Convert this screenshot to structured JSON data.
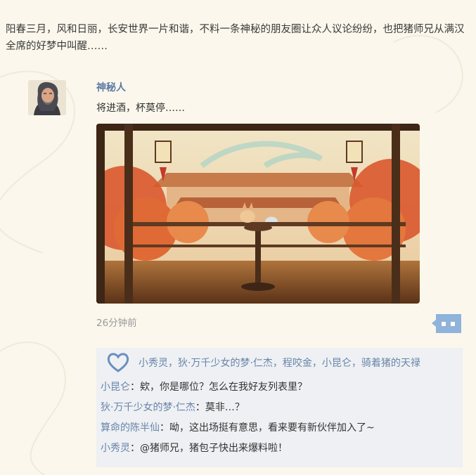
{
  "intro_text": "阳春三月，风和日丽，长安世界一片和谐，不料一条神秘的朋友圈让众人议论纷纷，也把猪师兄从满汉全席的好梦中叫醒……",
  "post": {
    "author": "神秘人",
    "text": "将进酒，杯莫停……",
    "time": "26分钟前",
    "image_alt": "autumn-pavilion-illustration"
  },
  "likes": "小秀灵，狄·万千少女的梦·仁杰，程咬金，小昆仑，骑着猪的天禄",
  "comments": [
    {
      "name": "小昆仑",
      "text": "：欸，你是哪位？怎么在我好友列表里？"
    },
    {
      "name": "狄·万千少女的梦·仁杰",
      "text": "：莫非…？"
    },
    {
      "name": "算命的陈半仙",
      "text": "：呦，这出场挺有意思，看来要有新伙伴加入了~"
    },
    {
      "name": "小秀灵",
      "text": "：@猪师兄，猪包子快出来爆料啦！"
    }
  ],
  "colors": {
    "background": "#fbf7ec",
    "name_blue": "#5c7aa3",
    "comment_bg": "#eef0f3",
    "time_gray": "#9a9a9a"
  }
}
